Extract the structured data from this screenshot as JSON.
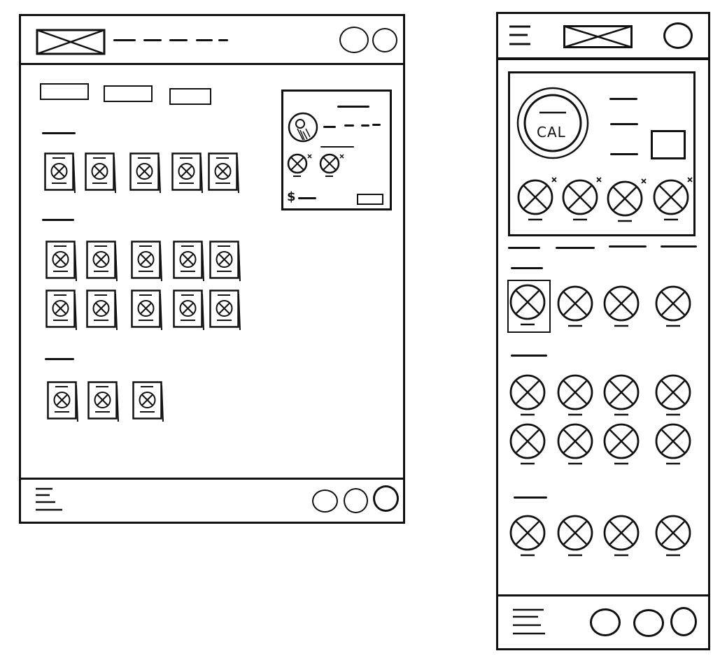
{
  "desktop": {
    "cart_panel": {
      "currency_symbol": "$"
    }
  },
  "mobile": {
    "summary_card": {
      "ring_label": "CAL"
    }
  }
}
